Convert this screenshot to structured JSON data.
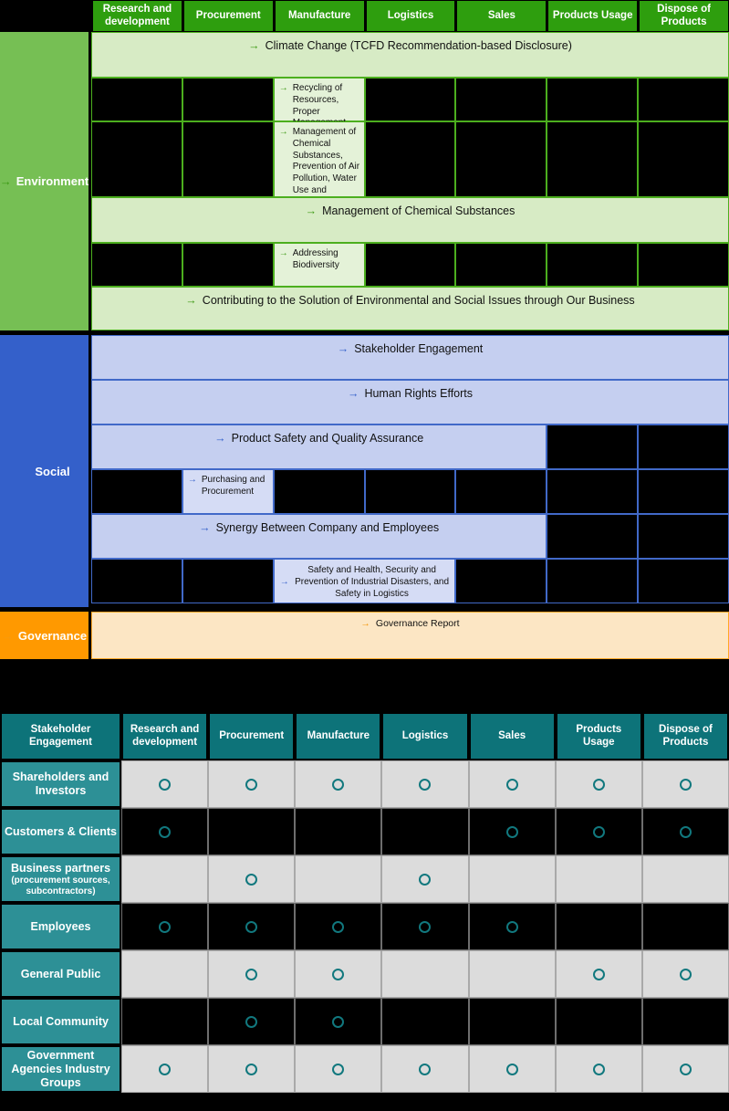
{
  "columns": [
    "Research and development",
    "Procurement",
    "Manufacture",
    "Logistics",
    "Sales",
    "Products Usage",
    "Dispose of Products"
  ],
  "colors": {
    "header_green": "#2E9E0E",
    "env_label_green": "#76BF54",
    "env_fill": "#D7EBC5",
    "env_border": "#4CAF1E",
    "social_blue": "#3460CA",
    "social_fill": "#C5CFF0",
    "governance_orange": "#FF9900",
    "governance_fill": "#FCE6C4",
    "teal_header": "#0D7379",
    "teal_rowlabel": "#2D9096",
    "circle_teal": "#11787E",
    "cell_light": "#DCDCDC",
    "cell_dark": "#000000"
  },
  "arrow_glyph": "→",
  "categories": {
    "environment": {
      "label": "Environment",
      "rows": [
        {
          "type": "full",
          "text": "Climate Change (TCFD Recommendation-based Disclosure)"
        },
        {
          "type": "cells",
          "text": "Recycling of Resources, Proper Management and Disposal of Waste",
          "start": 2,
          "span": 1
        },
        {
          "type": "cells",
          "text": "Management of Chemical Substances, Prevention of Air Pollution, Water Use and Prevention of Water Pollution",
          "start": 2,
          "span": 1
        },
        {
          "type": "full",
          "text": "Management of Chemical Substances"
        },
        {
          "type": "cells",
          "text": "Addressing Biodiversity",
          "start": 2,
          "span": 1
        },
        {
          "type": "full",
          "text": "Contributing to the Solution of Environmental and Social Issues through Our Business"
        }
      ]
    },
    "social": {
      "label": "Social",
      "rows": [
        {
          "type": "full",
          "text": "Stakeholder Engagement"
        },
        {
          "type": "full",
          "text": "Human Rights Efforts"
        },
        {
          "type": "cells",
          "text": "Product Safety and Quality Assurance",
          "start": 0,
          "span": 5
        },
        {
          "type": "cells",
          "text": "Purchasing and Procurement",
          "start": 1,
          "span": 1
        },
        {
          "type": "cells",
          "text": "Synergy Between Company and Employees",
          "start": 0,
          "span": 5
        },
        {
          "type": "cells",
          "text": "Safety and Health, Security and Prevention of Industrial Disasters, and Safety in Logistics",
          "start": 2,
          "span": 2
        }
      ]
    },
    "governance": {
      "label": "Governance",
      "rows": [
        {
          "type": "full",
          "text": "Governance Report"
        }
      ]
    }
  },
  "bottom_table": {
    "corner_header": "Stakeholder Engagement",
    "columns": [
      "Research and development",
      "Procurement",
      "Manufacture",
      "Logistics",
      "Sales",
      "Products Usage",
      "Dispose of Products"
    ],
    "rows": [
      {
        "label": "Shareholders and Investors",
        "sub": "",
        "shade": "light",
        "marks": [
          true,
          true,
          true,
          true,
          true,
          true,
          true
        ]
      },
      {
        "label": "Customers & Clients",
        "sub": "",
        "shade": "dark",
        "marks": [
          true,
          false,
          false,
          false,
          true,
          true,
          true
        ]
      },
      {
        "label": "Business partners",
        "sub": "(procurement sources, subcontractors)",
        "shade": "light",
        "marks": [
          false,
          true,
          false,
          true,
          false,
          false,
          false
        ]
      },
      {
        "label": "Employees",
        "sub": "",
        "shade": "dark",
        "marks": [
          true,
          true,
          true,
          true,
          true,
          false,
          false
        ]
      },
      {
        "label": "General Public",
        "sub": "",
        "shade": "light",
        "marks": [
          false,
          true,
          true,
          false,
          false,
          true,
          true
        ]
      },
      {
        "label": "Local Community",
        "sub": "",
        "shade": "dark",
        "marks": [
          false,
          true,
          true,
          false,
          false,
          false,
          false
        ]
      },
      {
        "label": "Government Agencies Industry Groups",
        "sub": "",
        "shade": "light",
        "marks": [
          true,
          true,
          true,
          true,
          true,
          true,
          true
        ]
      }
    ]
  }
}
